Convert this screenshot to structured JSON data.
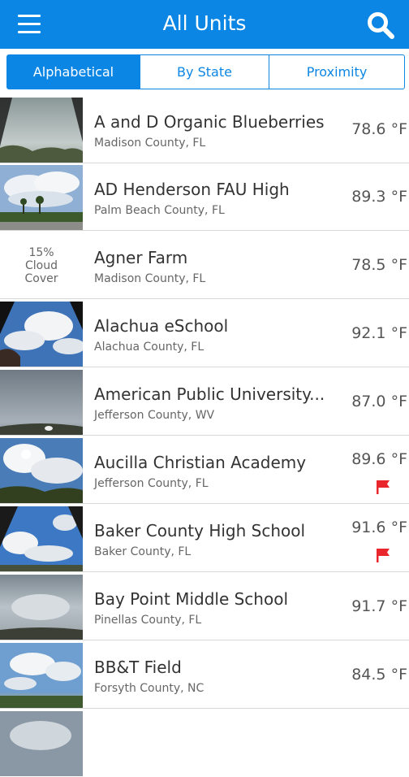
{
  "header": {
    "title": "All Units",
    "menu_icon": "hamburger-menu-icon",
    "search_icon": "search-icon"
  },
  "tabs": [
    {
      "label": "Alphabetical",
      "active": true
    },
    {
      "label": "By State",
      "active": false
    },
    {
      "label": "Proximity",
      "active": false
    }
  ],
  "units": [
    {
      "name": "A and D Organic Blueberries",
      "county": "Madison County, FL",
      "temp": "78.6 °F",
      "flag": false
    },
    {
      "name": "AD Henderson FAU High",
      "county": "Palm Beach County, FL",
      "temp": "89.3 °F",
      "flag": false
    },
    {
      "name": "Agner Farm",
      "county": "Madison County, FL",
      "temp": "78.5 °F",
      "flag": false,
      "cloud_line1": "15%",
      "cloud_line2": "Cloud",
      "cloud_line3": "Cover"
    },
    {
      "name": "Alachua eSchool",
      "county": "Alachua County, FL",
      "temp": "92.1 °F",
      "flag": false
    },
    {
      "name": "American Public University...",
      "county": "Jefferson County, WV",
      "temp": "87.0 °F",
      "flag": false
    },
    {
      "name": "Aucilla Christian Academy",
      "county": "Jefferson County, FL",
      "temp": "89.6 °F",
      "flag": true
    },
    {
      "name": "Baker County High School",
      "county": "Baker County, FL",
      "temp": "91.6 °F",
      "flag": true
    },
    {
      "name": "Bay Point Middle School",
      "county": "Pinellas County, FL",
      "temp": "91.7 °F",
      "flag": false
    },
    {
      "name": "BB&T Field",
      "county": "Forsyth County, NC",
      "temp": "84.5 °F",
      "flag": false
    }
  ],
  "colors": {
    "accent": "#0b86e4",
    "flag": "#e8262b"
  }
}
